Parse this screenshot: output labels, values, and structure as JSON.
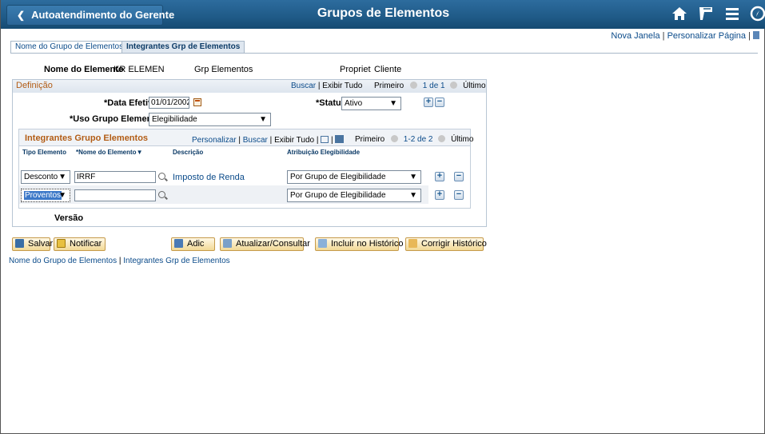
{
  "header": {
    "back_label": "Autoatendimento do Gerente",
    "title": "Grupos de Elementos",
    "icons": [
      "home-icon",
      "flag-icon",
      "menu-icon",
      "compass-icon"
    ]
  },
  "top_links": {
    "new_window": "Nova Janela",
    "separator": "|",
    "personalize": "Personalizar Página",
    "separator2": "|"
  },
  "tabs": [
    {
      "label": "Nome do Grupo de Elementos",
      "active": false
    },
    {
      "label": "Integrantes Grp de Elementos",
      "active": true
    }
  ],
  "info": {
    "element_name_label": "Nome do Elemento",
    "element_name_value": "KR ELEMEN",
    "element_group": "Grp Elementos",
    "owner_label": "Propriet",
    "owner_value": "Cliente"
  },
  "definition": {
    "title": "Definição",
    "search": "Buscar",
    "sep": "|",
    "show_all": "Exibir Tudo",
    "first": "Primeiro",
    "range": "1 de 1",
    "last": "Último",
    "effective_date_label": "*Data Efetiva",
    "effective_date_value": "01/01/2002",
    "status_label": "*Status",
    "status_value": "Ativo",
    "usage_label": "*Uso Grupo Elementos",
    "usage_value": "Elegibilidade",
    "version_label": "Versão"
  },
  "grid": {
    "title": "Integrantes Grupo Elementos",
    "personalize": "Personalizar",
    "sep": "|",
    "search": "Buscar",
    "show_all": "Exibir Tudo",
    "sep2": "|",
    "first": "Primeiro",
    "range": "1-2 de 2",
    "last": "Último",
    "columns": [
      "Tipo Elemento",
      "*Nome do Elemento",
      "Descrição",
      "Atribuição Elegibilidade"
    ],
    "rows": [
      {
        "type": "Desconto",
        "name": "IRRF",
        "description": "Imposto de Renda",
        "eligibility": "Por Grupo de Elegibilidade"
      },
      {
        "type": "Proventos",
        "name": "",
        "description": "",
        "eligibility": "Por Grupo de Elegibilidade"
      }
    ]
  },
  "actions": {
    "save": "Salvar",
    "notify": "Notificar",
    "add": "Adic",
    "update": "Atualizar/Consultar",
    "include_history": "Incluir no Histórico",
    "correct_history": "Corrigir Histórico"
  },
  "footer_links": {
    "group_name": "Nome do Grupo de Elementos",
    "sep": "|",
    "members": "Integrantes Grp de Elementos"
  }
}
